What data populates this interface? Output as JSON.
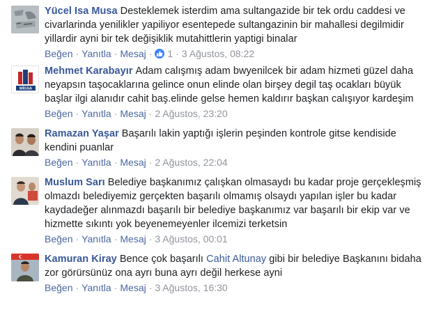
{
  "comments": [
    {
      "author": "Yücel Isa Musa",
      "text": "Desteklemek isterdim ama sultangazide bir tek ordu caddesi ve civarlarinda yenilikler yapiliyor esentepede sultangazinin bir mahallesi degilmidir yillardir ayni bir tek değişiklik mutahittlerin yaptigi binalar",
      "like_label": "Beğen",
      "reply_label": "Yanıtla",
      "message_label": "Mesaj",
      "like_count": "1",
      "date": "3 Ağustos, 08:22",
      "avatar_icon": "profile-photo-icon"
    },
    {
      "author": "Mehmet Karabayır",
      "text": "Adam calışmış adam bwyenilcek bir adam hizmeti güzel daha neyapsın taşocaklarına gelince onun elinde olan birşey degil taş ocakları büyük başlar ilgi alanıdır cahit baş.elinde gelse hemen kaldırır başkan calışıyor kardeşim",
      "like_label": "Beğen",
      "reply_label": "Yanıtla",
      "message_label": "Mesaj",
      "date": "2 Ağustos, 23:20",
      "avatar_icon": "migsa-logo-icon",
      "avatar_text": "MİGSA"
    },
    {
      "author": "Ramazan Yaşar",
      "text": "Başarılı lakin yaptığı işlerin peşinden kontrole gitse kendiside kendini puanlar",
      "like_label": "Beğen",
      "reply_label": "Yanıtla",
      "message_label": "Mesaj",
      "date": "2 Ağustos, 22:04",
      "avatar_icon": "profile-photo-icon"
    },
    {
      "author": "Muslum Sarı",
      "text": "Belediye başkanımız çalışkan olmasaydı bu kadar proje gerçekleşmiş olmazdı belediyemiz gerçekten başarılı olmamış olsaydı yapılan işler bu kadar kaydadeğer alınmazdı başarılı bir belediye başkanımız var başarılı bir ekip var ve hizmette sıkıntı yok beyenemeyenler ilcemizi terketsin",
      "like_label": "Beğen",
      "reply_label": "Yanıtla",
      "message_label": "Mesaj",
      "date": "3 Ağustos, 00:01",
      "avatar_icon": "profile-photo-icon"
    },
    {
      "author": "Kamuran Kiray",
      "text_before": "Bence çok başarılı",
      "mention": "Cahit Altunay",
      "text_after": "gibi bir belediye Başkanını bidaha zor görürsünüz ona ayrı buna ayrı değil herkese ayni",
      "like_label": "Beğen",
      "reply_label": "Yanıtla",
      "message_label": "Mesaj",
      "date": "3 Ağustos, 16:30",
      "avatar_icon": "profile-photo-icon"
    }
  ],
  "colors": {
    "author": "#385898",
    "action_link": "#4b67a1",
    "meta": "#90949c",
    "like_badge": "#4080ff"
  }
}
